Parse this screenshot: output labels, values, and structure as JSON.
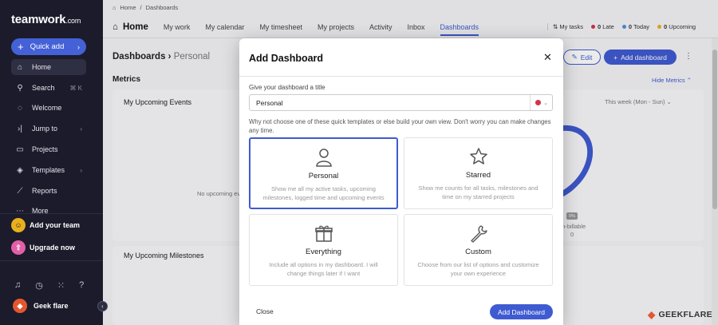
{
  "sidebar": {
    "logo_main": "teamwork",
    "logo_suffix": ".com",
    "quick_add": "Quick add",
    "items": [
      {
        "label": "Home",
        "icon": "home-icon"
      },
      {
        "label": "Search",
        "icon": "search-icon",
        "shortcut": "⌘ K"
      },
      {
        "label": "Welcome",
        "icon": "chat-icon"
      },
      {
        "label": "Jump to",
        "icon": "jump-icon"
      },
      {
        "label": "Projects",
        "icon": "folder-icon"
      },
      {
        "label": "Templates",
        "icon": "templates-icon"
      },
      {
        "label": "Reports",
        "icon": "reports-icon"
      },
      {
        "label": "More",
        "icon": "more-icon"
      }
    ],
    "add_team": "Add your team",
    "upgrade": "Upgrade now",
    "user_name": "Geek flare"
  },
  "breadcrumb": {
    "home": "Home",
    "sep": "/",
    "current": "Dashboards"
  },
  "topnav": {
    "home": "Home",
    "tabs": [
      "My work",
      "My calendar",
      "My timesheet",
      "My projects",
      "Activity",
      "Inbox",
      "Dashboards"
    ],
    "my_tasks": "My tasks",
    "late_count": "0",
    "late_label": "Late",
    "today_count": "0",
    "today_label": "Today",
    "upcoming_count": "0",
    "upcoming_label": "Upcoming"
  },
  "page": {
    "title": "Dashboards",
    "subtitle": "Personal",
    "edit": "Edit",
    "add_dashboard": "Add dashboard",
    "metrics": "Metrics",
    "hide_metrics": "Hide Metrics",
    "events_title": "My Upcoming Events",
    "events_range": "This week (Mon - Sun)",
    "no_events": "No upcoming ev",
    "milestones_title": "My Upcoming Milestones",
    "pct": "0%",
    "non_billable": "on-billable",
    "non_billable_value": "0"
  },
  "modal": {
    "title": "Add Dashboard",
    "field_label": "Give your dashboard a title",
    "title_value": "Personal",
    "hint": "Why not choose one of these quick templates or else build your own view. Don't worry you can make changes any time.",
    "templates": [
      {
        "name": "Personal",
        "desc": "Show me all my active tasks, upcoming milestones, logged time and upcoming events"
      },
      {
        "name": "Starred",
        "desc": "Show me counts for all tasks, milestones and time on my starred projects"
      },
      {
        "name": "Everything",
        "desc": "Include all options in my dashboard. I will change things later if I want"
      },
      {
        "name": "Custom",
        "desc": "Choose from our list of options and customize your own experience"
      }
    ],
    "close": "Close",
    "add": "Add Dashboard"
  },
  "colors": {
    "accent": "#3f5bd1",
    "sidebar": "#1b1b2b",
    "late": "#d2344d",
    "today": "#4a90e2",
    "upcoming": "#e8b01c"
  },
  "watermark": "GEEKFLARE"
}
